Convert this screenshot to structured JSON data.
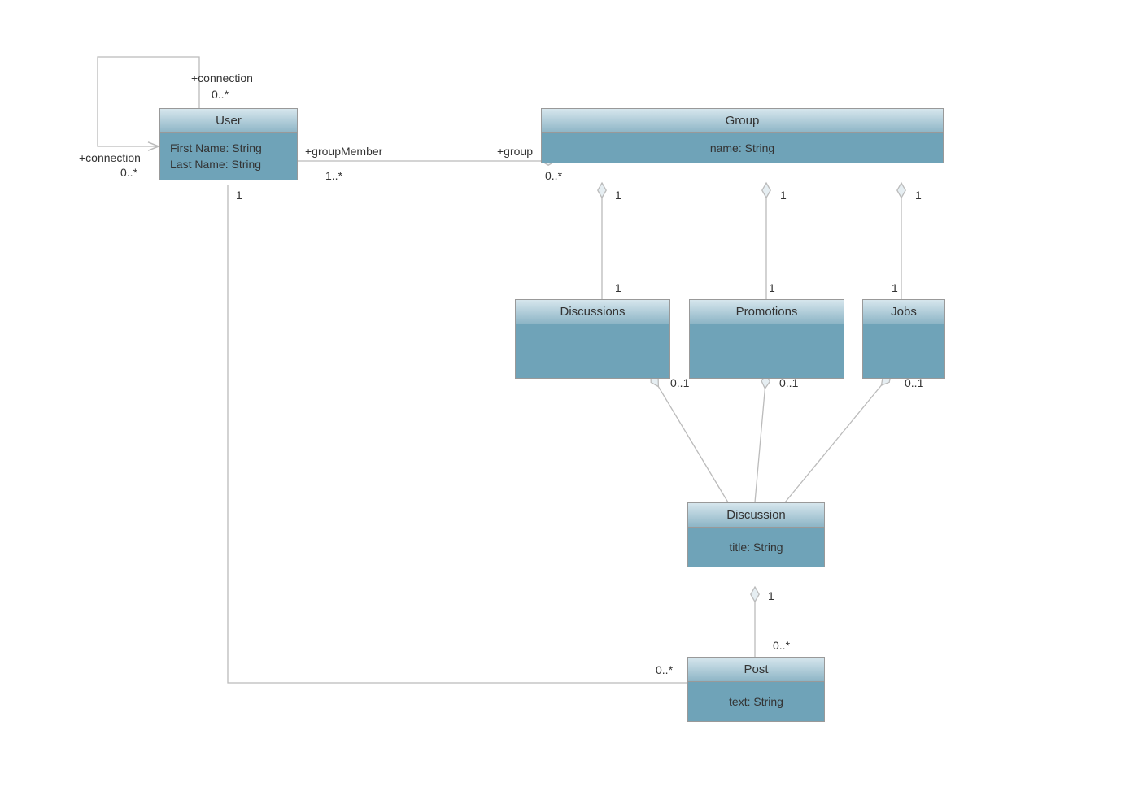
{
  "classes": {
    "user": {
      "title": "User",
      "attrs": [
        "First Name: String",
        "Last Name: String"
      ]
    },
    "group": {
      "title": "Group",
      "attrs": [
        "name: String"
      ]
    },
    "discussions": {
      "title": "Discussions"
    },
    "promotions": {
      "title": "Promotions"
    },
    "jobs": {
      "title": "Jobs"
    },
    "discussion": {
      "title": "Discussion",
      "attrs": [
        "title: String"
      ]
    },
    "post": {
      "title": "Post",
      "attrs": [
        "text: String"
      ]
    }
  },
  "labels": {
    "connTop": "+connection",
    "connTopMult": "0..*",
    "connLeft": "+connection",
    "connLeftMult": "0..*",
    "groupMember": "+groupMember",
    "groupMemberMult": "1..*",
    "groupRole": "+group",
    "groupMult": "0..*",
    "userOne": "1",
    "groupDiscOne": "1",
    "groupPromOne": "1",
    "groupJobsOne": "1",
    "discTopOne": "1",
    "promTopOne": "1",
    "jobsTopOne": "1",
    "discBotMult": "0..1",
    "promBotMult": "0..1",
    "jobsBotMult": "0..1",
    "discussionOne": "1",
    "postMult": "0..*",
    "userPostMult": "0..*"
  }
}
